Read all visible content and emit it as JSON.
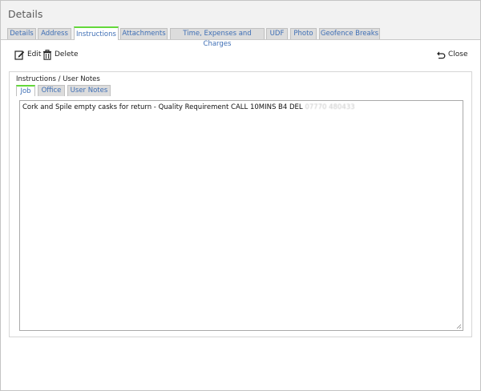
{
  "window": {
    "title": "Details"
  },
  "tabs": [
    {
      "label": "Details"
    },
    {
      "label": "Address"
    },
    {
      "label": "Instructions"
    },
    {
      "label": "Attachments"
    },
    {
      "label": "Time, Expenses and Charges"
    },
    {
      "label": "UDF"
    },
    {
      "label": "Photo"
    },
    {
      "label": "Geofence Breaks"
    }
  ],
  "toolbar": {
    "edit_label": "Edit",
    "delete_label": "Delete",
    "close_label": "Close"
  },
  "panel": {
    "label": "Instructions / User Notes",
    "subtabs": [
      {
        "label": "Job"
      },
      {
        "label": "Office"
      },
      {
        "label": "User Notes"
      }
    ],
    "text": "Cork and Spile empty casks for return - Quality Requirement CALL 10MINS B4 DEL",
    "text_redacted": "07770 480433"
  },
  "colors": {
    "accent_green": "#63d83a",
    "tab_text": "#3f6fb5"
  },
  "icons": {
    "edit": "edit-icon",
    "delete": "trash-icon",
    "close": "undo-arrow-icon"
  }
}
